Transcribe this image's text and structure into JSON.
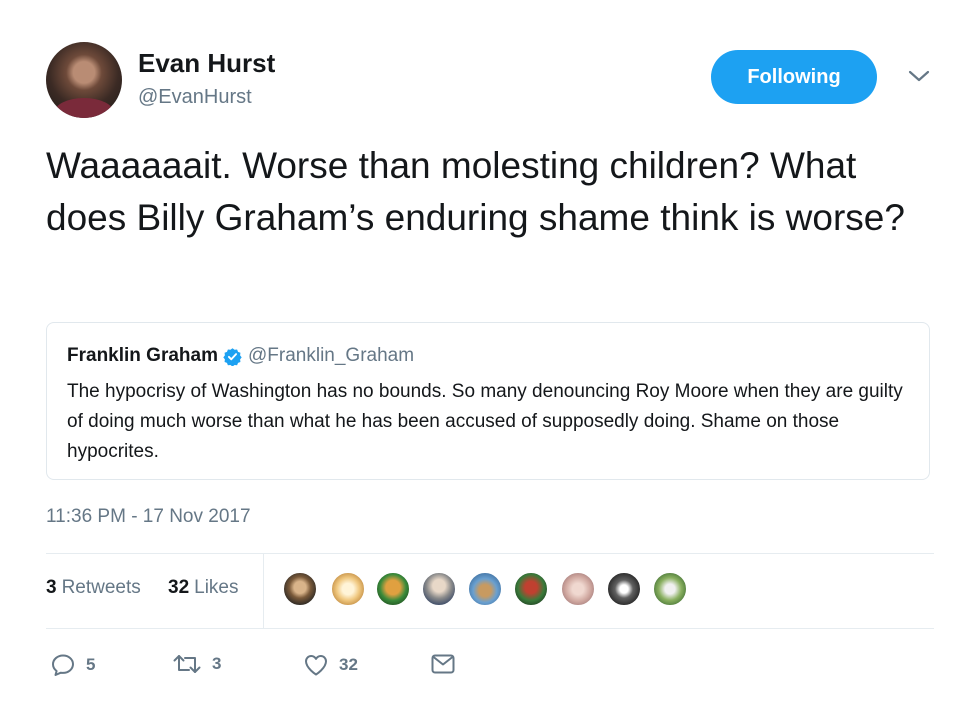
{
  "author": {
    "name": "Evan Hurst",
    "handle": "@EvanHurst",
    "follow_label": "Following"
  },
  "tweet": {
    "text": "Waaaaaait. Worse than molesting children? What does Billy Graham’s enduring shame think is worse?"
  },
  "quoted_tweet": {
    "name": "Franklin Graham",
    "handle": "@Franklin_Graham",
    "text": "The hypocrisy of Washington has no bounds. So many denouncing Roy Moore when they are guilty of doing much worse than what he has been accused of supposedly doing. Shame on those hypocrites."
  },
  "timestamp": "11:36 PM - 17 Nov 2017",
  "stats": {
    "retweets_count": "3",
    "retweets_label": "Retweets",
    "likes_count": "32",
    "likes_label": "Likes"
  },
  "actions": {
    "reply_count": "5",
    "retweet_count": "3",
    "like_count": "32"
  },
  "colors": {
    "accent": "#1da1f2",
    "secondary_text": "#657786",
    "primary_text": "#14171a",
    "border": "#e1e8ed"
  }
}
